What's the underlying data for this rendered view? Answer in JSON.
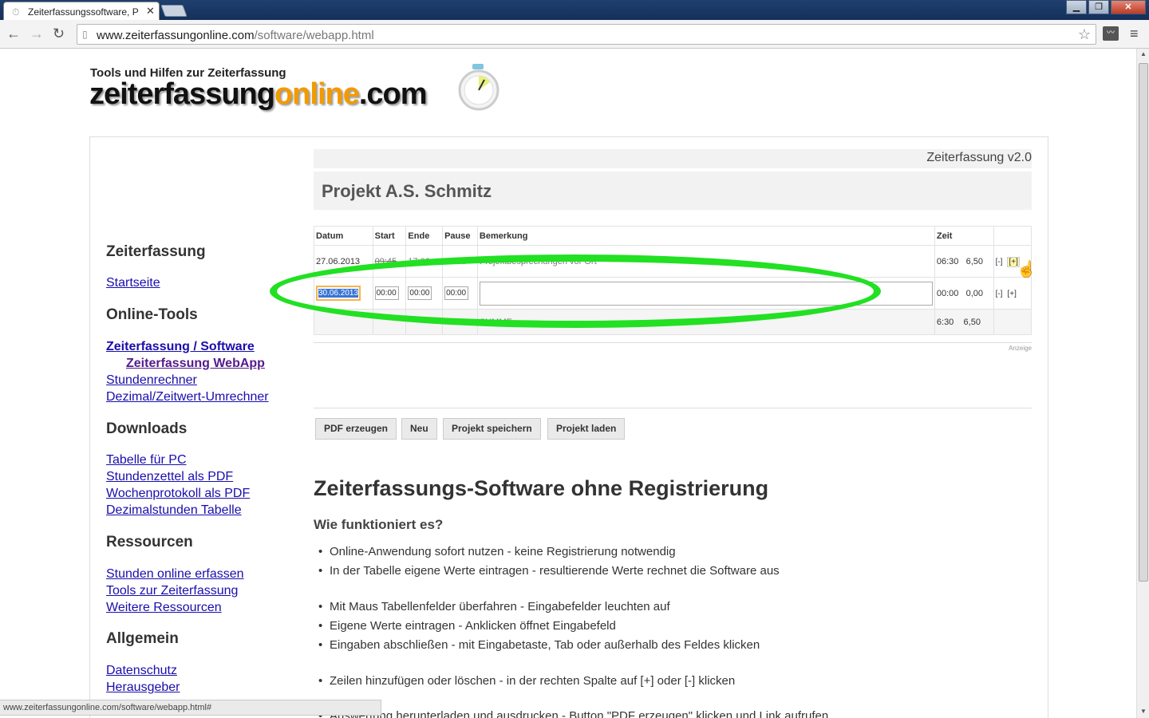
{
  "browser": {
    "tab_title": "Zeiterfassungssoftware, P",
    "url_host": "www.zeiterfassungonline.com",
    "url_path": "/software/webapp.html",
    "status_url": "www.zeiterfassungonline.com/software/webapp.html#"
  },
  "logo": {
    "tagline": "Tools und Hilfen zur Zeiterfassung",
    "part1": "zeiterfassung",
    "part2": "online",
    "part3": ".com"
  },
  "sidebar": {
    "sections": [
      {
        "title": "Zeiterfassung",
        "links": [
          "Startseite"
        ]
      },
      {
        "title": "Online-Tools",
        "links": [
          "Zeiterfassung / Software",
          "Zeiterfassung WebApp",
          "Stundenrechner",
          "Dezimal/Zeitwert-Umrechner"
        ]
      },
      {
        "title": "Downloads",
        "links": [
          "Tabelle für PC",
          "Stundenzettel als PDF",
          "Wochenprotokoll als PDF",
          "Dezimalstunden Tabelle"
        ]
      },
      {
        "title": "Ressourcen",
        "links": [
          "Stunden online erfassen",
          "Tools zur Zeiterfassung",
          "Weitere Ressourcen"
        ]
      },
      {
        "title": "Allgemein",
        "links": [
          "Datenschutz",
          "Herausgeber"
        ]
      }
    ]
  },
  "app": {
    "version": "Zeiterfassung v2.0",
    "project_title": "Projekt A.S. Schmitz",
    "columns": [
      "Datum",
      "Start",
      "Ende",
      "Pause",
      "Bemerkung",
      "Zeit"
    ],
    "row1": {
      "datum": "27.06.2013",
      "start": "09:45",
      "ende": "17:00",
      "pause": "00:45",
      "bemerkung": "Projektbesprechungen vor Ort",
      "zeit": "06:30",
      "dezimal": "6,50"
    },
    "row2": {
      "datum": "30.06.2013",
      "start": "00:00",
      "ende": "00:00",
      "pause": "00:00",
      "zeit": "00:00",
      "dezimal": "0,00"
    },
    "sum": {
      "label": "SUMME",
      "zeit": "6:30",
      "dezimal": "6,50"
    },
    "row_minus": "[-]",
    "row_plus": "[+]",
    "ad_label": "Anzeige",
    "buttons": [
      "PDF erzeugen",
      "Neu",
      "Projekt speichern",
      "Projekt laden"
    ]
  },
  "article": {
    "heading": "Zeiterfassungs-Software ohne Registrierung",
    "subheading": "Wie funktioniert es?",
    "bullets": [
      "Online-Anwendung sofort nutzen - keine Registrierung notwendig",
      "In der Tabelle eigene Werte eintragen - resultierende Werte rechnet die Software aus",
      "Mit Maus Tabellenfelder überfahren - Eingabefelder leuchten auf",
      "Eigene Werte eintragen - Anklicken öffnet Eingabefeld",
      "Eingaben abschließen - mit Eingabetaste, Tab oder außerhalb des Feldes klicken",
      "Zeilen hinzufügen oder löschen - in der rechten Spalte auf [+] oder [-] klicken",
      "Auswertung herunterladen und ausdrucken - Button \"PDF erzeugen\" klicken und Link aufrufen"
    ]
  },
  "colors": {
    "accent_online": "#f29a00",
    "highlight_ellipse": "#22e022",
    "link": "#1a0dab"
  }
}
